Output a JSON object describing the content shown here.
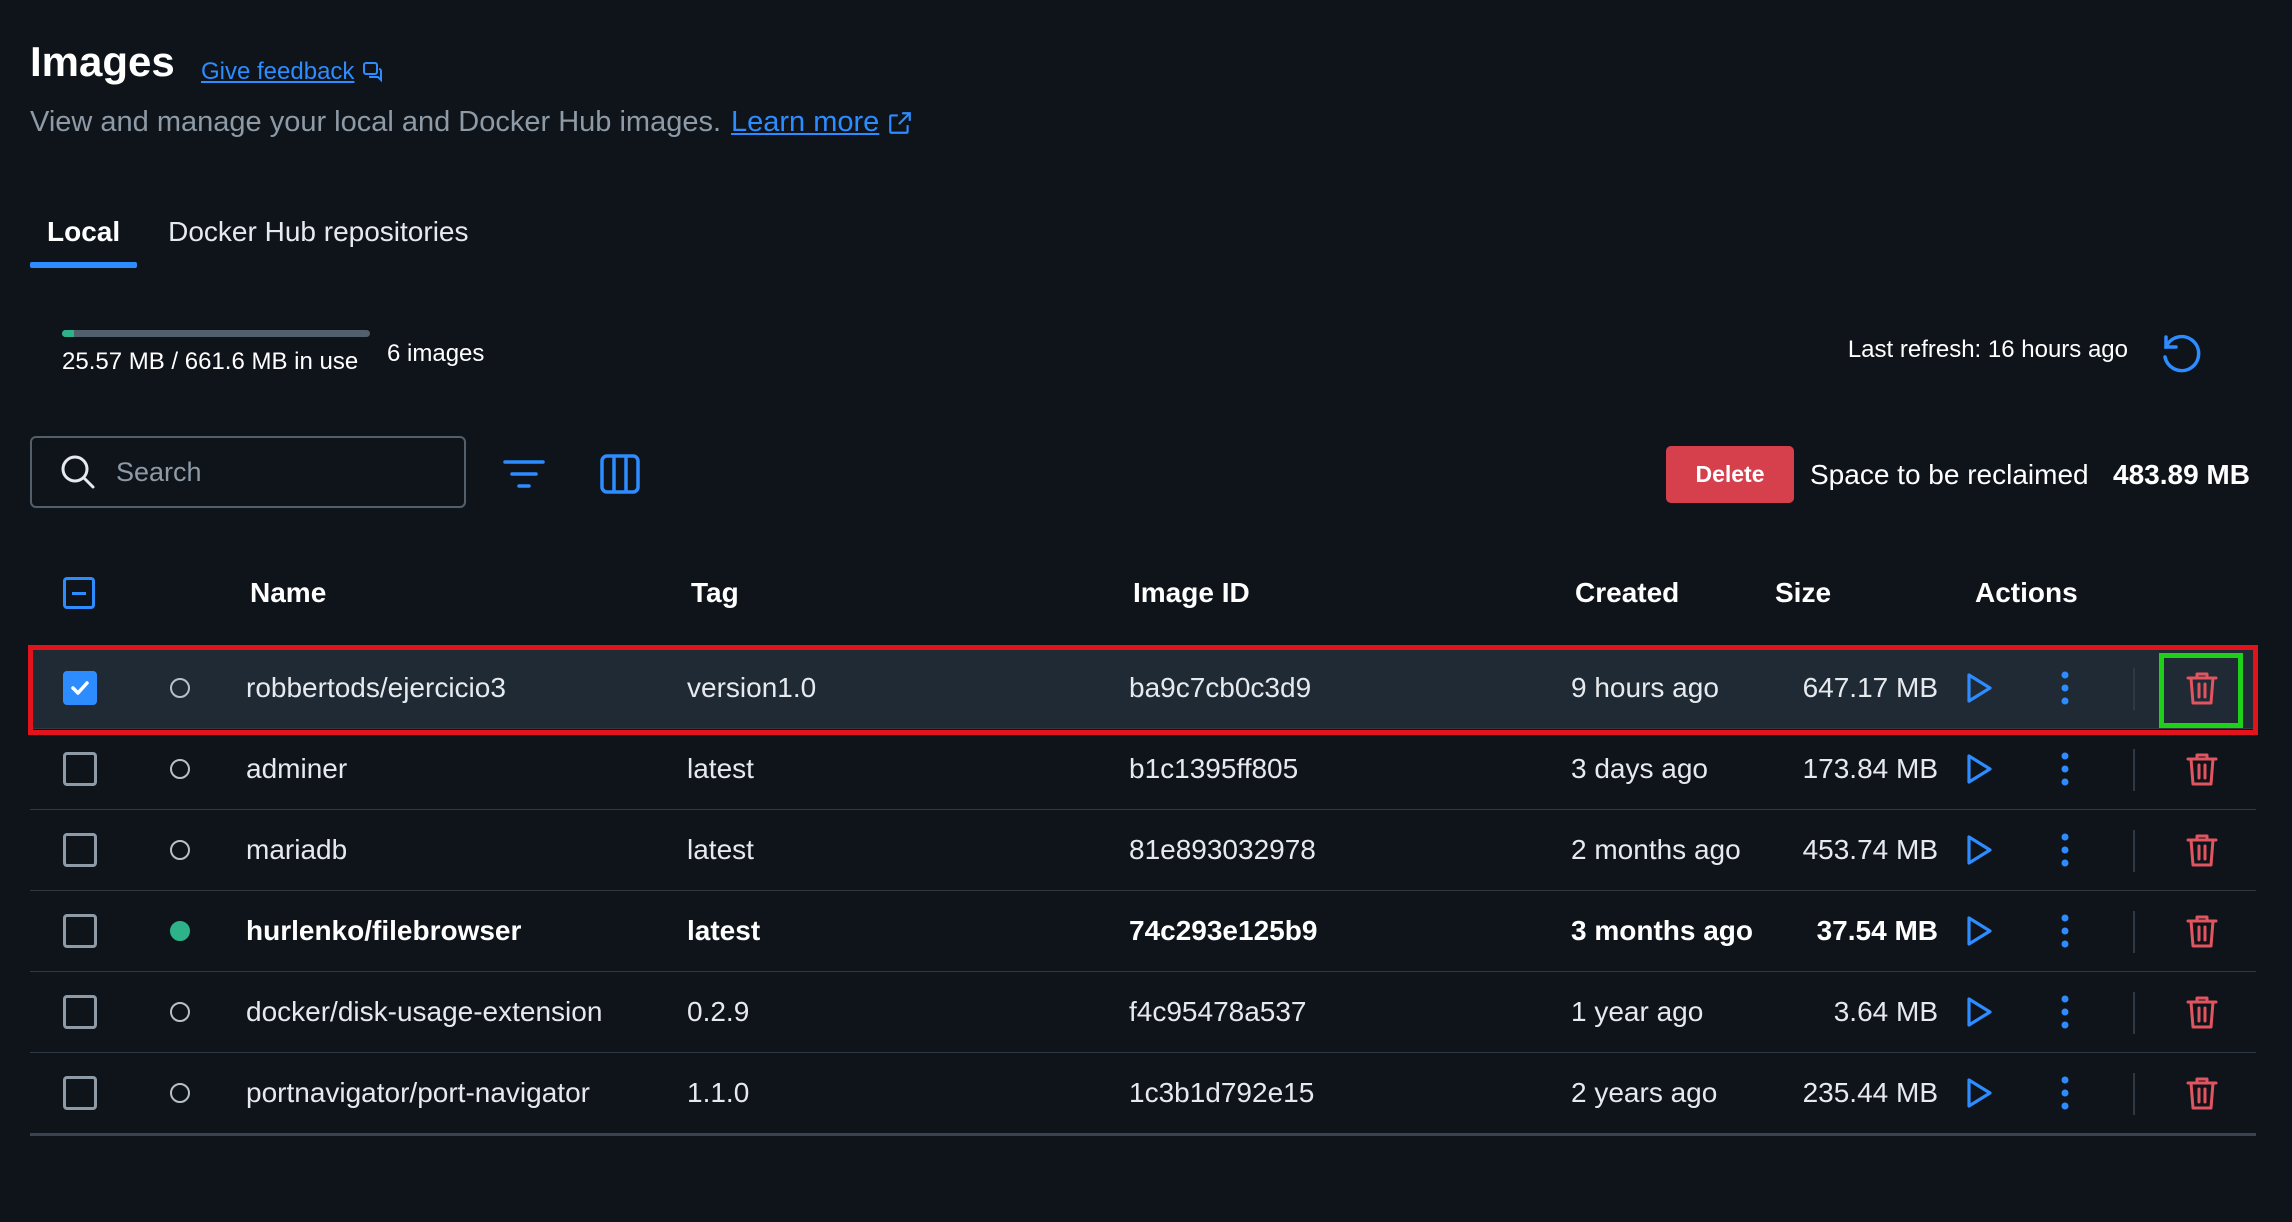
{
  "header": {
    "title": "Images",
    "feedback_label": "Give feedback",
    "subtitle": "View and manage your local and Docker Hub images.",
    "learn_more_label": "Learn more"
  },
  "tabs": [
    {
      "label": "Local",
      "active": true
    },
    {
      "label": "Docker Hub repositories",
      "active": false
    }
  ],
  "usage": {
    "text": "25.57 MB / 661.6 MB in use",
    "fraction": 0.0387,
    "count_text": "6 images",
    "last_refresh": "Last refresh: 16 hours ago"
  },
  "toolbar": {
    "search_placeholder": "Search",
    "delete_label": "Delete",
    "reclaim_label": "Space to be reclaimed",
    "reclaim_value": "483.89 MB"
  },
  "table": {
    "columns": {
      "name": "Name",
      "tag": "Tag",
      "image_id": "Image ID",
      "created": "Created",
      "size": "Size",
      "actions": "Actions"
    },
    "rows": [
      {
        "name": "robbertods/ejercicio3",
        "tag": "version1.0",
        "image_id": "ba9c7cb0c3d9",
        "created": "9 hours ago",
        "size": "647.17 MB",
        "checked": true,
        "in_use": false
      },
      {
        "name": "adminer",
        "tag": "latest",
        "image_id": "b1c1395ff805",
        "created": "3 days ago",
        "size": "173.84 MB",
        "checked": false,
        "in_use": false
      },
      {
        "name": "mariadb",
        "tag": "latest",
        "image_id": "81e893032978",
        "created": "2 months ago",
        "size": "453.74 MB",
        "checked": false,
        "in_use": false
      },
      {
        "name": "hurlenko/filebrowser",
        "tag": "latest",
        "image_id": "74c293e125b9",
        "created": "3 months ago",
        "size": "37.54 MB",
        "checked": false,
        "in_use": true
      },
      {
        "name": "docker/disk-usage-extension",
        "tag": "0.2.9",
        "image_id": "f4c95478a537",
        "created": "1 year ago",
        "size": "3.64 MB",
        "checked": false,
        "in_use": false
      },
      {
        "name": "portnavigator/port-navigator",
        "tag": "1.1.0",
        "image_id": "1c3b1d792e15",
        "created": "2 years ago",
        "size": "235.44 MB",
        "checked": false,
        "in_use": false
      }
    ]
  },
  "colors": {
    "accent": "#2d8cff",
    "danger": "#d6404c",
    "in_use": "#2db28a",
    "background": "#0f141b"
  },
  "icons": {
    "feedback": "feedback-icon",
    "external": "external-link-icon",
    "refresh": "refresh-icon",
    "search": "search-icon",
    "filter": "filter-icon",
    "columns": "columns-icon",
    "run": "play-icon",
    "more": "more-vertical-icon",
    "delete": "trash-icon"
  }
}
